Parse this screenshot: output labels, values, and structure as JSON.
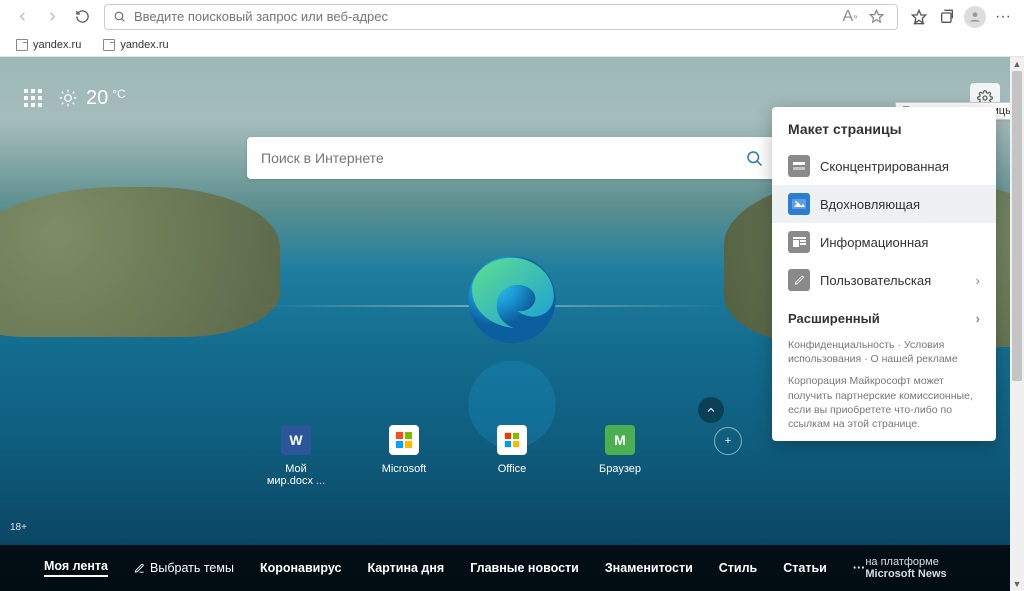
{
  "chrome": {
    "address_placeholder": "Введите поисковый запрос или веб-адрес",
    "tabs": [
      "yandex.ru",
      "yandex.ru"
    ]
  },
  "tooltip": "Параметры страницы",
  "weather": {
    "temp": "20",
    "unit": "°C"
  },
  "search": {
    "placeholder": "Поиск в Интернете"
  },
  "quicklinks": [
    {
      "label": "Мой мир.docx ...",
      "bg": "#2b579a",
      "fg": "#ffffff",
      "letter": "W"
    },
    {
      "label": "Microsoft",
      "bg": "#ffffff",
      "fg": "#000000",
      "letter": ""
    },
    {
      "label": "Office",
      "bg": "#ffffff",
      "fg": "#000000",
      "letter": ""
    },
    {
      "label": "Браузер",
      "bg": "#4caf50",
      "fg": "#ffffff",
      "letter": "M"
    }
  ],
  "age_badge": "18+",
  "feed": {
    "items": [
      "Моя лента",
      "Выбрать темы",
      "Коронавирус",
      "Картина дня",
      "Главные новости",
      "Знаменитости",
      "Стиль",
      "Статьи"
    ],
    "more": "···",
    "provider_prefix": "на платформе",
    "provider_name": "Microsoft News"
  },
  "menu": {
    "title": "Макет страницы",
    "options": [
      "Сконцентрированная",
      "Вдохновляющая",
      "Информационная",
      "Пользовательская"
    ],
    "expand": "Расширенный",
    "footer1_a": "Конфиденциальность",
    "footer1_b": "Условия использования",
    "footer1_c": "О нашей рекламе",
    "footer2": "Корпорация Майкрософт может получить партнерские комиссионные, если вы приобретете что-либо по ссылкам на этой странице."
  }
}
